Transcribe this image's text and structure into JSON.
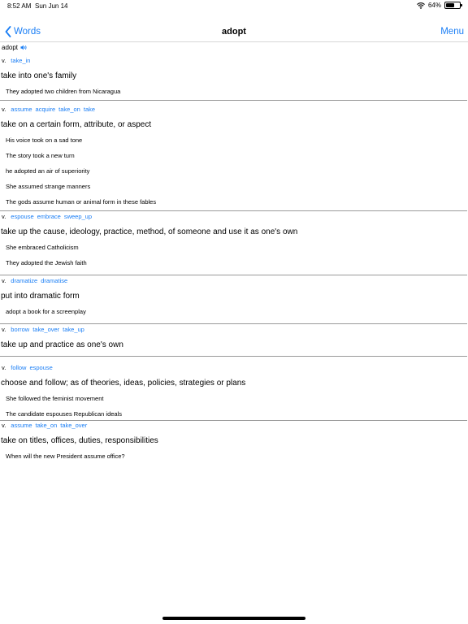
{
  "status_bar": {
    "time": "8:52 AM",
    "date": "Sun Jun 14",
    "battery_text": "64%",
    "battery_level": 0.64
  },
  "nav": {
    "back_label": "Words",
    "title": "adopt",
    "menu_label": "Menu"
  },
  "word": "adopt",
  "senses": [
    {
      "pos": "v.",
      "synonyms": [
        "take_in"
      ],
      "definition": "take into one's family",
      "examples": [
        "They adopted two children from Nicaragua"
      ]
    },
    {
      "pos": "v.",
      "synonyms": [
        "assume",
        "acquire",
        "take_on",
        "take"
      ],
      "definition": "take on a certain form, attribute, or aspect",
      "examples": [
        "His voice took on a sad tone",
        "The story took a new turn",
        "he adopted an air of superiority",
        "She assumed strange manners",
        "The gods assume human or animal form in these fables"
      ]
    },
    {
      "pos": "v.",
      "synonyms": [
        "espouse",
        "embrace",
        "sweep_up"
      ],
      "definition": "take up the cause, ideology, practice, method, of someone and use it as one's own",
      "examples": [
        "She embraced Catholicism",
        "They adopted the Jewish faith"
      ]
    },
    {
      "pos": "v.",
      "synonyms": [
        "dramatize",
        "dramatise"
      ],
      "definition": "put into dramatic form",
      "examples": [
        "adopt a book for a screenplay"
      ]
    },
    {
      "pos": "v.",
      "synonyms": [
        "borrow",
        "take_over",
        "take_up"
      ],
      "definition": "take up and practice as one's own",
      "examples": []
    },
    {
      "pos": "v.",
      "synonyms": [
        "follow",
        "espouse"
      ],
      "definition": "choose and follow; as of theories, ideas, policies, strategies or plans",
      "examples": [
        "She followed the feminist movement",
        "The candidate espouses Republican ideals"
      ]
    },
    {
      "pos": "v.",
      "synonyms": [
        "assume",
        "take_on",
        "take_over"
      ],
      "definition": "take on titles, offices, duties, responsibilities",
      "examples": [
        "When will the new President assume office?"
      ]
    }
  ],
  "colors": {
    "accent": "#1a7ef5",
    "divider": "#9a9a9a"
  }
}
